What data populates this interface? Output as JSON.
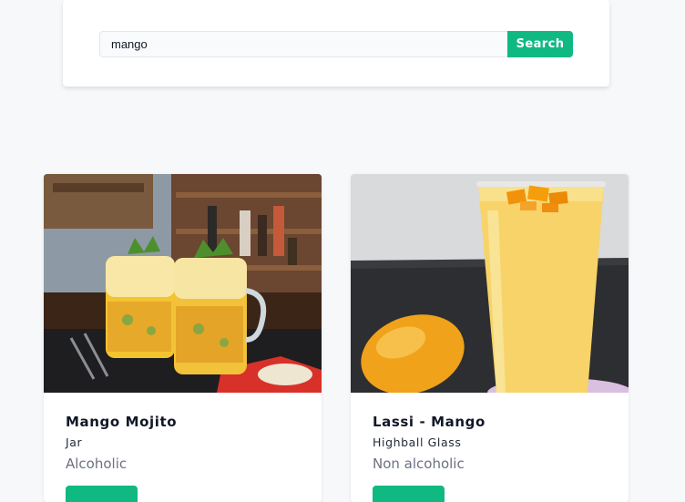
{
  "search": {
    "value": "mango",
    "button_label": "Search"
  },
  "results": [
    {
      "title": "Mango Mojito",
      "glass": "Jar",
      "type": "Alcoholic",
      "image_icon": "mango-mojito-photo"
    },
    {
      "title": "Lassi - Mango",
      "glass": "Highball Glass",
      "type": "Non alcoholic",
      "image_icon": "lassi-mango-photo"
    }
  ],
  "colors": {
    "accent": "#10b981",
    "background": "#f7f8fa"
  }
}
